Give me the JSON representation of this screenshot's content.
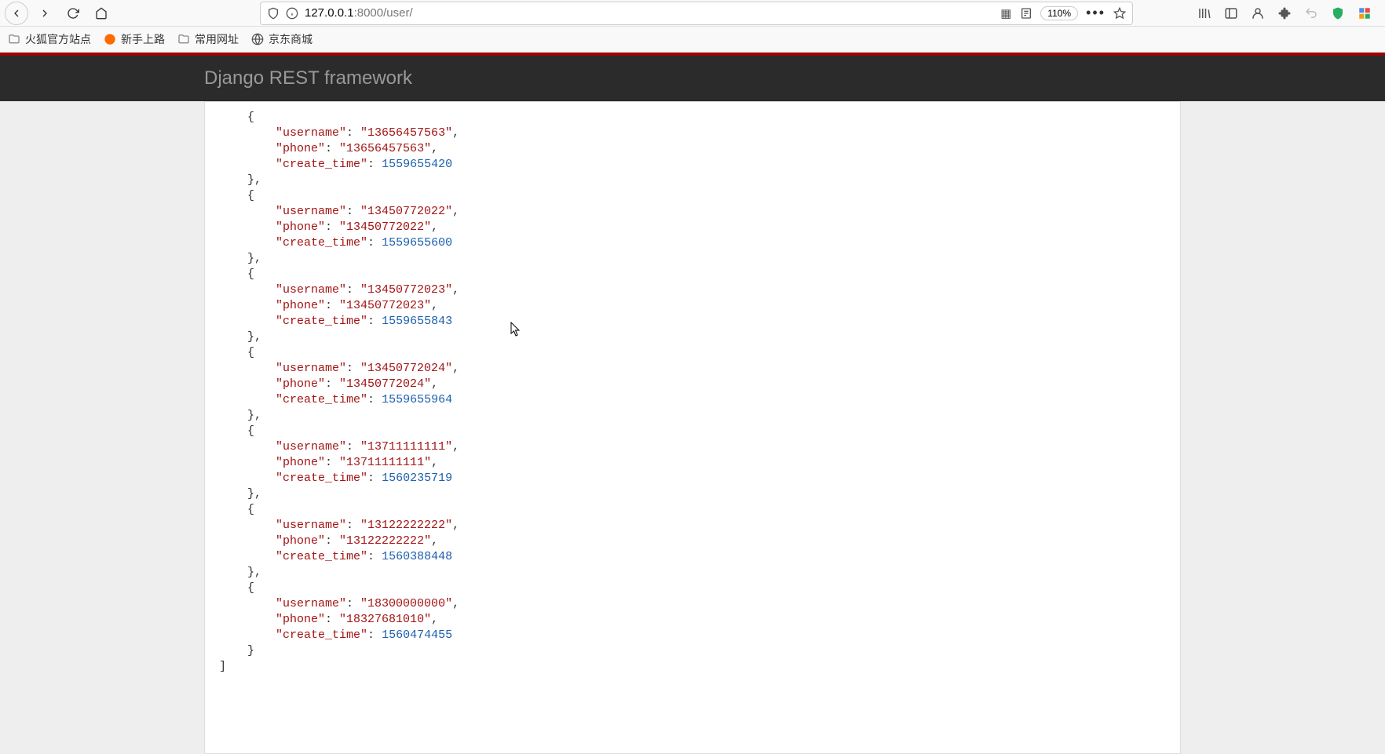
{
  "toolbar": {
    "url_host": "127.0.0.1",
    "url_path": ":8000/user/",
    "zoom": "110%",
    "nav": {
      "back": "Back",
      "forward": "Forward",
      "reload": "Reload",
      "home": "Home"
    }
  },
  "bookmarks": [
    {
      "label": "火狐官方站点",
      "icon": "folder"
    },
    {
      "label": "新手上路",
      "icon": "firefox"
    },
    {
      "label": "常用网址",
      "icon": "folder"
    },
    {
      "label": "京东商城",
      "icon": "globe"
    }
  ],
  "drf": {
    "title": "Django REST framework"
  },
  "json_data": {
    "users": [
      {
        "username": "13656457563",
        "phone": "13656457563",
        "create_time": 1559655420
      },
      {
        "username": "13450772022",
        "phone": "13450772022",
        "create_time": 1559655600
      },
      {
        "username": "13450772023",
        "phone": "13450772023",
        "create_time": 1559655843
      },
      {
        "username": "13450772024",
        "phone": "13450772024",
        "create_time": 1559655964
      },
      {
        "username": "13711111111",
        "phone": "13711111111",
        "create_time": 1560235719
      },
      {
        "username": "13122222222",
        "phone": "13122222222",
        "create_time": 1560388448
      },
      {
        "username": "18300000000",
        "phone": "18327681010",
        "create_time": 1560474455
      }
    ]
  }
}
